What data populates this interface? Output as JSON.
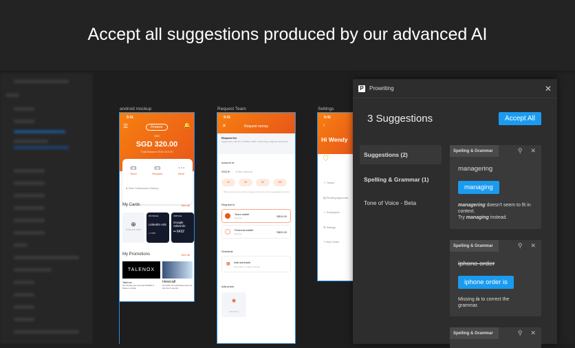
{
  "headline": "Accept all suggestions produced by our advanced AI",
  "frames": {
    "android": {
      "label": "android mockup",
      "time": "9:41",
      "dropdown": "Finance",
      "balance_label": "SGD",
      "balance": "SGD 320.00",
      "sub_balance": "Total Balance SGD 510.00",
      "actions": [
        "Send",
        "Request",
        "More"
      ],
      "history": "View Transaction History",
      "cards_title": "My Cards",
      "see_all": "See all",
      "add_card": "Add new card",
      "cards": [
        {
          "type": "PHYSICAL",
          "name": "LinkedIn Ads",
          "num": "•• 7745"
        },
        {
          "type": "VIRTUAL",
          "name": "Google Adwords",
          "num": "•• 6432"
        }
      ],
      "promos_title": "My Promotions",
      "promos": [
        {
          "brand": "TALENOX",
          "name": "Talenox",
          "desc": "Get 30-day free trial and SGD60 in Talenox credits"
        },
        {
          "brand": "",
          "name": "Hewcall",
          "desc": "Get 20% off subscription fees for the first 3 months"
        }
      ]
    },
    "request": {
      "label": "Request Team",
      "time": "9:41",
      "title": "Request money",
      "req_for": "Request for",
      "req_for_desc": "Approver will be notified after entering request amount.",
      "amount_of": "Amount of",
      "currency": "SGD",
      "amount_placeholder": "Enter amount",
      "chips": [
        "10",
        "25",
        "50",
        "100"
      ],
      "hint": "*Enter amount you want to request or tap any of the suggested amounts",
      "request_to": "Request to",
      "wallets": [
        {
          "name": "Team wallet",
          "sub": "Receive",
          "amount": "S$10.00"
        },
        {
          "name": "Personal wallet",
          "sub": "Receive",
          "amount": "S$20.00"
        }
      ],
      "schedule": "Schedule",
      "add_schedule": "Add schedule",
      "schedule_desc": "Send later or make recurring",
      "add_photo": "Add photo",
      "photo_btn": "Add photo"
    },
    "settings": {
      "label": "Settings",
      "time": "9:41",
      "greeting": "Hi Wendy",
      "items": [
        "Teams",
        "Pending Approvals",
        "Employees",
        "Settings",
        "Help Center"
      ]
    }
  },
  "panel": {
    "app_name": "Prowriting",
    "title": "3 Suggestions",
    "accept_all": "Accept All",
    "nav": [
      "Suggestions (2)",
      "Spelling & Grammar (1)",
      "Tone of Voice - Beta"
    ],
    "cards": [
      {
        "tag": "Spelling & Grammar",
        "original": "managering",
        "suggestion": "managing",
        "expl_em1": "managering",
        "expl_1": " doesn't seem to fit in context.",
        "expl_2": "Try ",
        "expl_em2": "managing",
        "expl_3": " instead."
      },
      {
        "tag": "Spelling & Grammar",
        "original": "iphone order",
        "suggestion": "iphone order is",
        "expl_1": "Missing ",
        "expl_em1": "is",
        "expl_2": " to correct the grammar."
      },
      {
        "tag": "Spelling & Grammar"
      }
    ]
  },
  "colors": {
    "accent": "#1a9bf0",
    "brand_orange": "#f26b14"
  }
}
